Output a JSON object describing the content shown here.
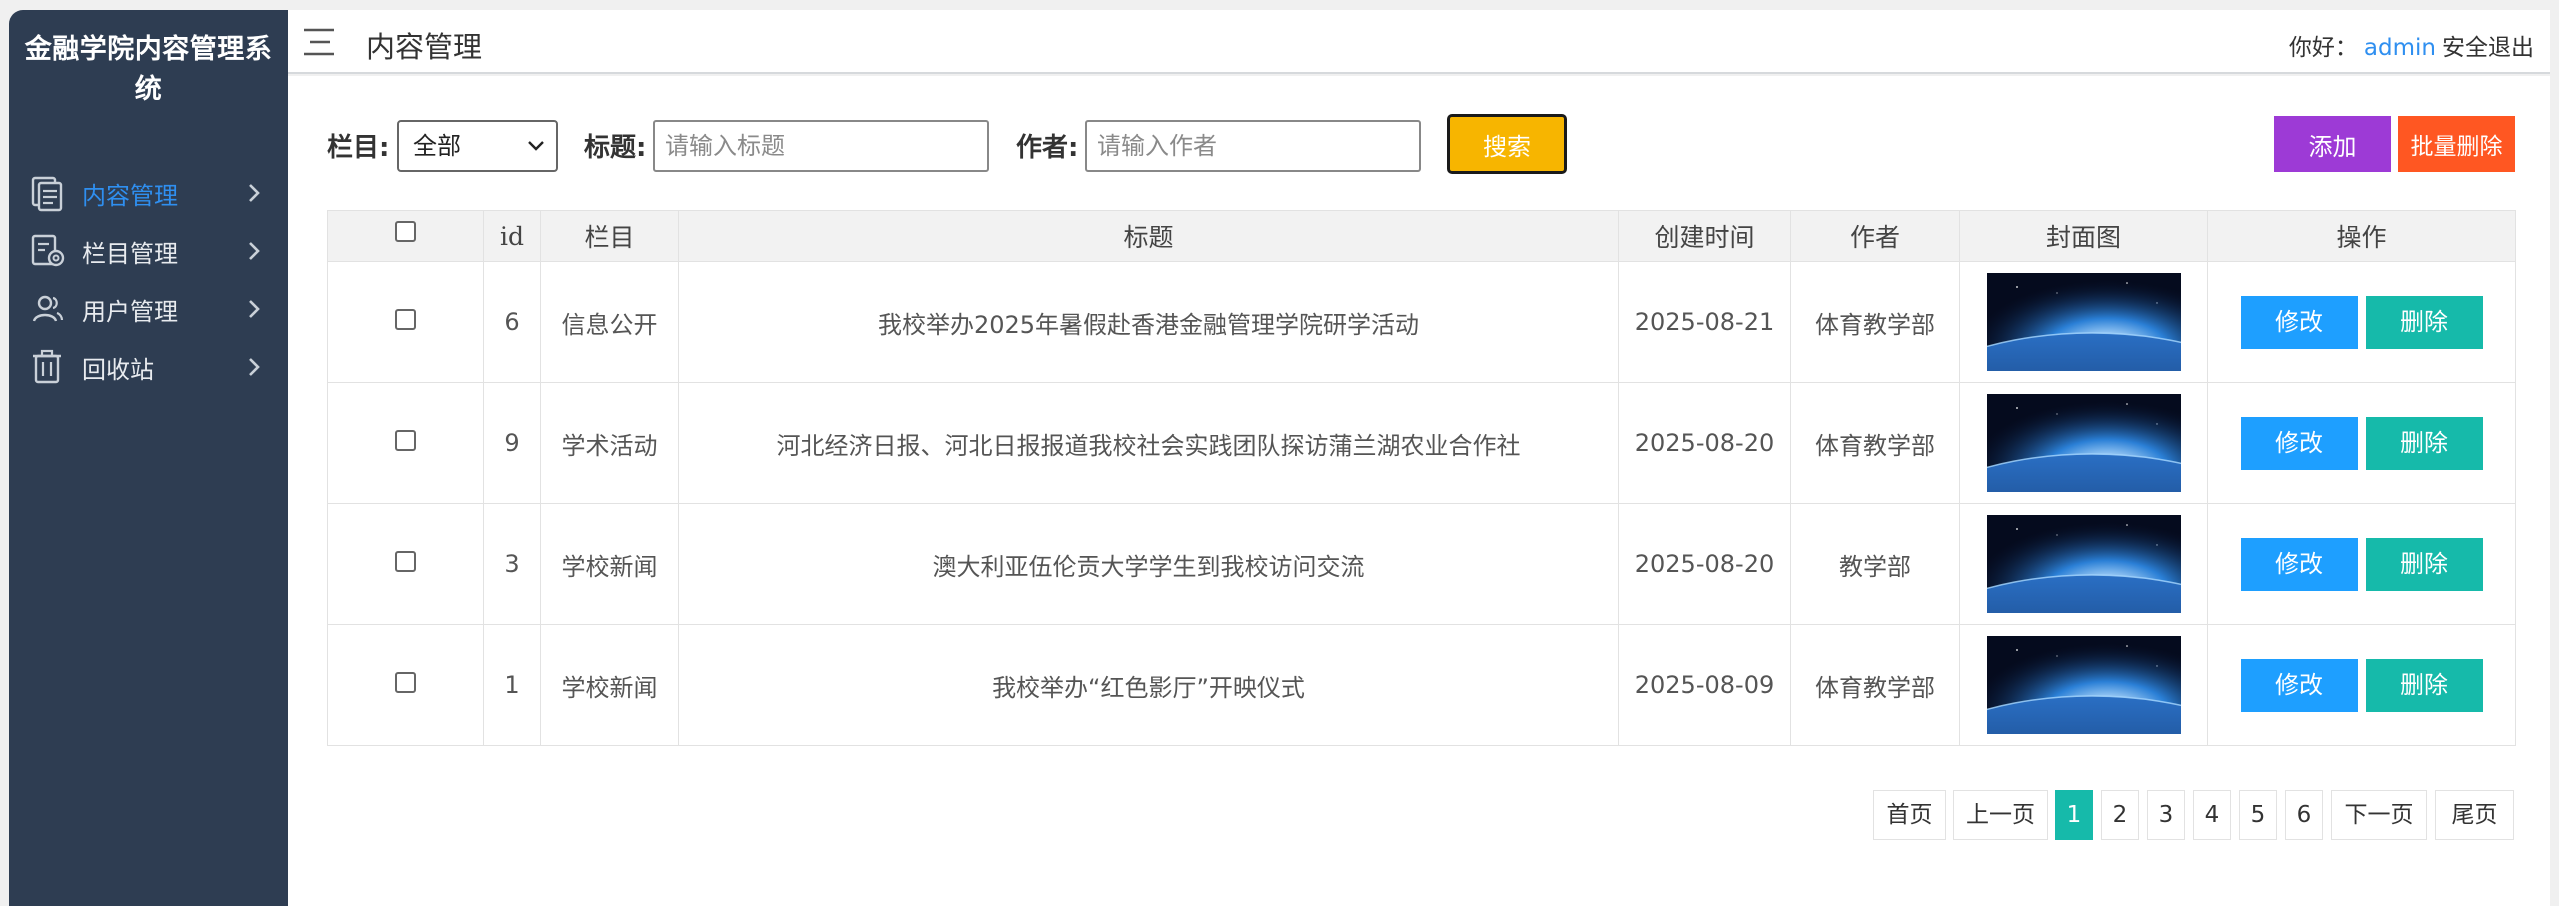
{
  "sidebar": {
    "brand": "金融学院内容管理系统",
    "items": [
      {
        "label": "内容管理",
        "icon": "content-icon",
        "active": true
      },
      {
        "label": "栏目管理",
        "icon": "column-settings-icon",
        "active": false
      },
      {
        "label": "用户管理",
        "icon": "user-icon",
        "active": false
      },
      {
        "label": "回收站",
        "icon": "trash-icon",
        "active": false
      }
    ]
  },
  "header": {
    "title": "内容管理",
    "greeting": "你好：",
    "username": "admin",
    "logout": "安全退出"
  },
  "filters": {
    "column_label": "栏目:",
    "column_value": "全部",
    "title_label": "标题:",
    "title_placeholder": "请输入标题",
    "author_label": "作者:",
    "author_placeholder": "请输入作者",
    "search_button": "搜索",
    "add_button": "添加",
    "batch_delete_button": "批量删除"
  },
  "table": {
    "headers": [
      "id",
      "栏目",
      "标题",
      "创建时间",
      "作者",
      "封面图",
      "操作"
    ],
    "rows": [
      {
        "id": "6",
        "column": "信息公开",
        "title": "我校举办2025年暑假赴香港金融管理学院研学活动",
        "date": "2025-08-21",
        "author": "体育教学部",
        "edit": "修改",
        "delete": "删除"
      },
      {
        "id": "9",
        "column": "学术活动",
        "title": "河北经济日报、河北日报报道我校社会实践团队探访蒲兰湖农业合作社",
        "date": "2025-08-20",
        "author": "体育教学部",
        "edit": "修改",
        "delete": "删除"
      },
      {
        "id": "3",
        "column": "学校新闻",
        "title": "澳大利亚伍伦贡大学学生到我校访问交流",
        "date": "2025-08-20",
        "author": "教学部",
        "edit": "修改",
        "delete": "删除"
      },
      {
        "id": "1",
        "column": "学校新闻",
        "title": "我校举办“红色影厅”开映仪式",
        "date": "2025-08-09",
        "author": "体育教学部",
        "edit": "修改",
        "delete": "删除"
      }
    ]
  },
  "pagination": {
    "first": "首页",
    "prev": "上一页",
    "pages": [
      "1",
      "2",
      "3",
      "4",
      "5",
      "6"
    ],
    "current": "1",
    "next": "下一页",
    "last": "尾页"
  },
  "colors": {
    "sidebar_bg": "#2e3d52",
    "active_blue": "#2f8ff0",
    "search_yellow": "#f7b500",
    "add_purple": "#9d3ad6",
    "batch_delete_orange": "#ff5722",
    "edit_blue": "#1e9fff",
    "delete_teal": "#16baaa"
  }
}
